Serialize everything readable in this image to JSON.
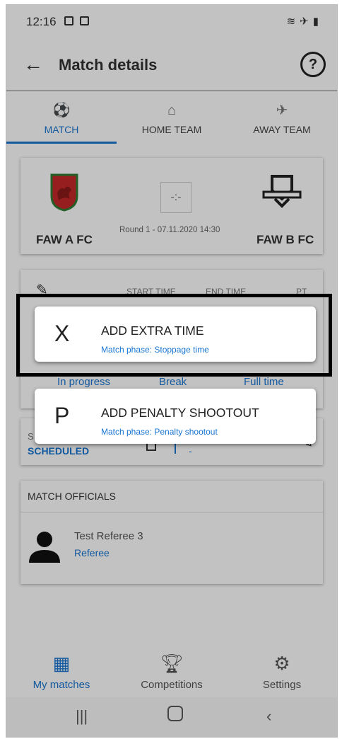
{
  "status": {
    "time": "12:16",
    "right_icons": [
      "wifi-icon",
      "airplane-icon",
      "battery-icon"
    ]
  },
  "appbar": {
    "title": "Match details",
    "help_glyph": "?"
  },
  "tabs": [
    {
      "label": "MATCH",
      "icon": "soccer-ball-icon",
      "active": true
    },
    {
      "label": "HOME TEAM",
      "icon": "home-icon",
      "active": false
    },
    {
      "label": "AWAY TEAM",
      "icon": "plane-icon",
      "active": false
    }
  ],
  "match": {
    "home_team": "FAW A FC",
    "away_team": "FAW B FC",
    "score": "-:-",
    "round_info": "Round 1 - 07.11.2020 14:30"
  },
  "times": {
    "headers": [
      "START TIME",
      "END TIME",
      "PT"
    ],
    "phases": [
      "In progress",
      "Break",
      "Full time"
    ]
  },
  "status_card": {
    "label": "S",
    "value": "SCHEDULED",
    "extra": "-"
  },
  "officials": {
    "header": "MATCH OFFICIALS",
    "items": [
      {
        "name": "Test Referee 3",
        "role": "Referee"
      }
    ]
  },
  "popups": [
    {
      "letter": "X",
      "title": "ADD EXTRA TIME",
      "subtitle": "Match phase: Stoppage time"
    },
    {
      "letter": "P",
      "title": "ADD PENALTY SHOOTOUT",
      "subtitle": "Match phase: Penalty shootout"
    }
  ],
  "bottom_nav": [
    {
      "label": "My matches",
      "icon": "calendar-grid-icon",
      "active": true
    },
    {
      "label": "Competitions",
      "icon": "trophy-icon",
      "active": false
    },
    {
      "label": "Settings",
      "icon": "gear-icon",
      "active": false
    }
  ],
  "colors": {
    "accent": "#1976d2",
    "dim_overlay": "rgba(0,0,0,0.24)",
    "highlight_border": "#000000"
  }
}
